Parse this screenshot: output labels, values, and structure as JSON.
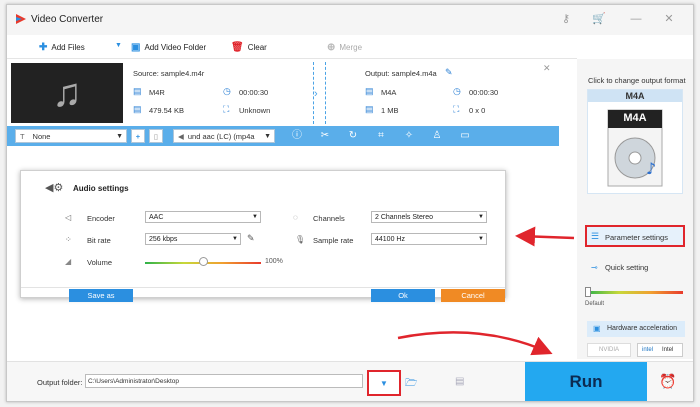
{
  "app": {
    "title": "Video Converter"
  },
  "toolbar": {
    "add_files": "Add Files",
    "add_folder": "Add Video Folder",
    "clear": "Clear",
    "merge": "Merge"
  },
  "file": {
    "source": "Source: sample4.m4r",
    "src_format": "M4R",
    "src_duration": "00:00:30",
    "src_size": "479.54 KB",
    "src_resolution": "Unknown",
    "output": "Output: sample4.m4a",
    "out_format": "M4A",
    "out_duration": "00:00:30",
    "out_size": "1 MB",
    "out_resolution": "0 x 0"
  },
  "editbar": {
    "subtitle": "None",
    "audio_track": "und aac (LC) (mp4a"
  },
  "dialog": {
    "title": "Audio settings",
    "encoder_label": "Encoder",
    "encoder_value": "AAC",
    "bitrate_label": "Bit rate",
    "bitrate_value": "256 kbps",
    "volume_label": "Volume",
    "volume_value": "100%",
    "volume_level": 0.5,
    "channels_label": "Channels",
    "channels_value": "2 Channels Stereo",
    "samplerate_label": "Sample rate",
    "samplerate_value": "44100 Hz",
    "save_as": "Save as",
    "ok": "Ok",
    "cancel": "Cancel"
  },
  "panel": {
    "hint": "Click to change output format",
    "format": "M4A",
    "badge": "M4A",
    "param_settings": "Parameter settings",
    "quick_setting": "Quick setting",
    "default_label": "Default",
    "hw_accel": "Hardware acceleration",
    "nvidia": "NVIDIA",
    "intel": "Intel"
  },
  "bottom": {
    "folder_label": "Output folder:",
    "folder_path": "C:\\Users\\Administrator\\Desktop",
    "run": "Run"
  },
  "colors": {
    "accent": "#23a8f0",
    "highlight_red": "#e0252c",
    "cancel": "#f08a24"
  }
}
